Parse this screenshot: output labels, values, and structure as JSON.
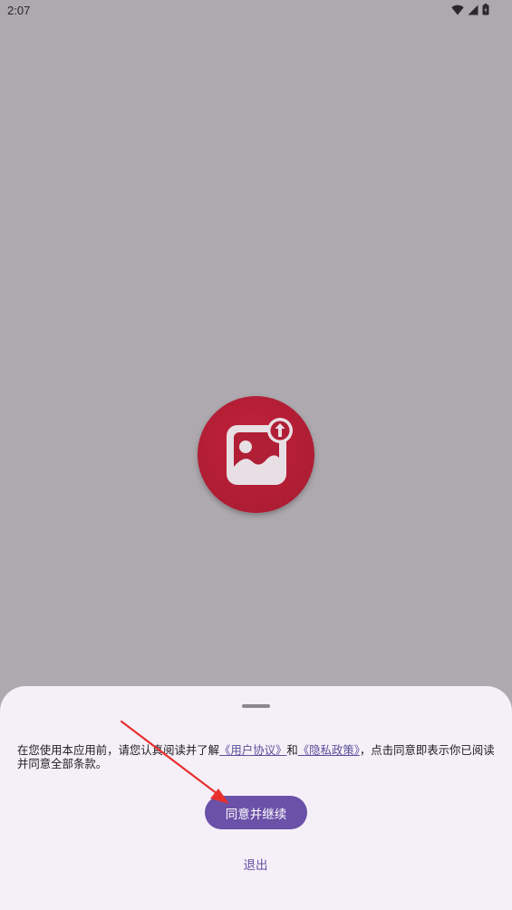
{
  "status_bar": {
    "time": "2:07",
    "icons": [
      "wifi-icon",
      "cellular-signal-icon",
      "battery-icon"
    ]
  },
  "app_logo": {
    "icon": "image-upload-icon",
    "color": "#b01f35"
  },
  "consent_sheet": {
    "text_before": "在您使用本应用前，请您认真阅读并了解",
    "user_agreement_link": "《用户协议》",
    "text_middle": "和",
    "privacy_policy_link": "《隐私政策》",
    "text_after": "，点击同意即表示你已阅读并同意全部条款。",
    "agree_button": "同意并继续",
    "exit_button": "退出"
  },
  "colors": {
    "scrim": "#ada9ae",
    "sheet_background": "#f5f0f8",
    "primary": "#6b51a8",
    "annotation_arrow": "#e8302f"
  }
}
